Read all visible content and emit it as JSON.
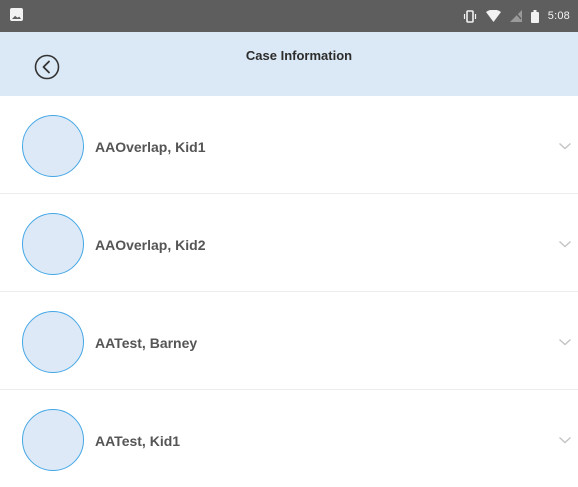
{
  "status_bar": {
    "time": "5:08",
    "icons": [
      "image-icon",
      "vibrate-icon",
      "wifi-icon",
      "no-signal-icon",
      "battery-icon"
    ]
  },
  "header": {
    "title": "Case Information",
    "back_icon": "back-circle-icon",
    "background_color": "#dbe8f5"
  },
  "list": {
    "items": [
      {
        "name": "AAOverlap, Kid1",
        "avatar_icon": "avatar-placeholder",
        "expand_icon": "chevron-down-icon"
      },
      {
        "name": "AAOverlap, Kid2",
        "avatar_icon": "avatar-placeholder",
        "expand_icon": "chevron-down-icon"
      },
      {
        "name": "AATest, Barney",
        "avatar_icon": "avatar-placeholder",
        "expand_icon": "chevron-down-icon"
      },
      {
        "name": "AATest, Kid1",
        "avatar_icon": "avatar-placeholder",
        "expand_icon": "chevron-down-icon"
      }
    ]
  },
  "colors": {
    "accent": "#44a7e6",
    "avatar_fill": "#dde9f6",
    "status_bar": "#5e5e5e"
  }
}
